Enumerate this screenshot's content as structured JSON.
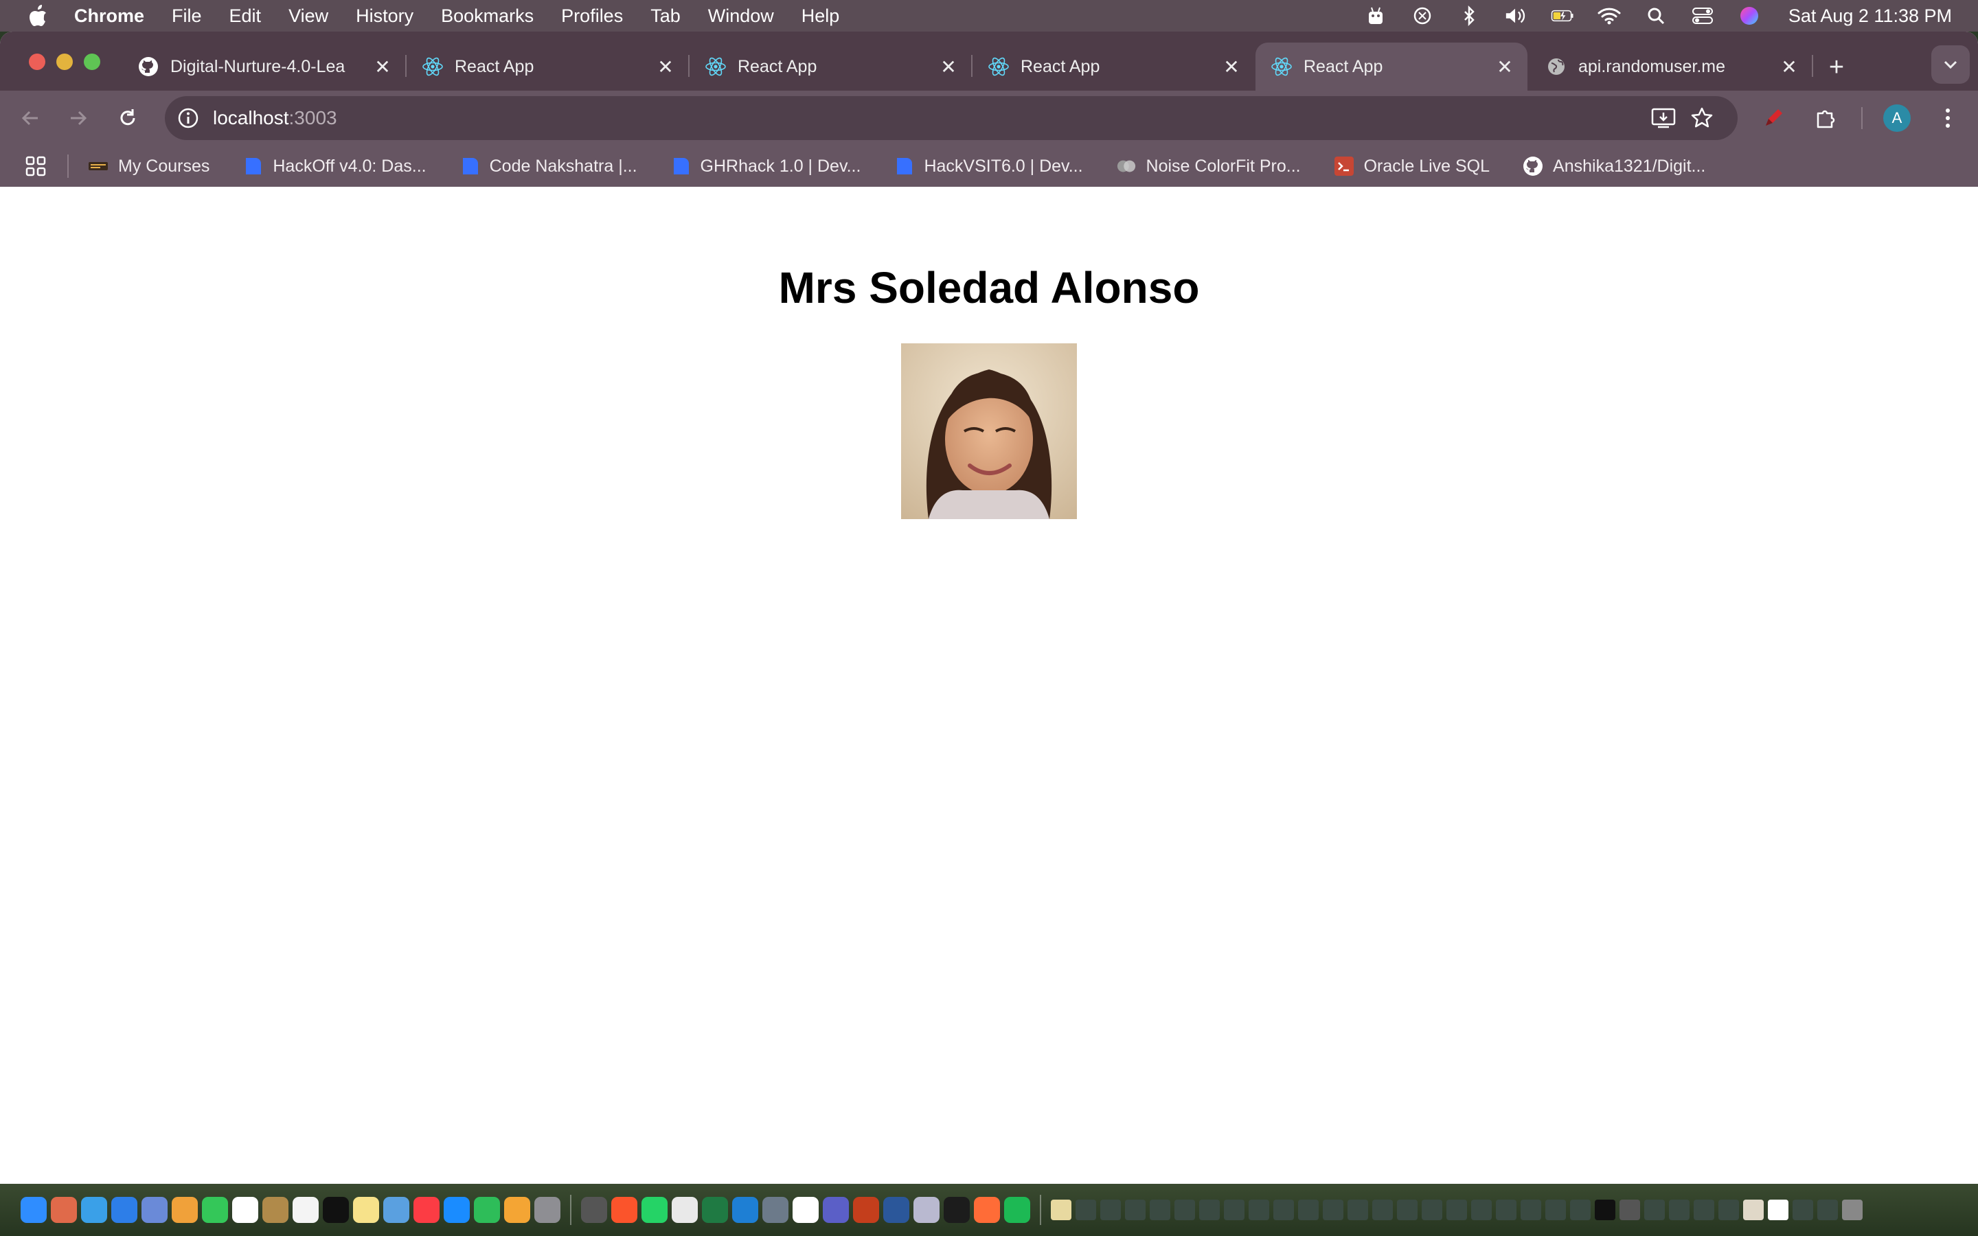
{
  "menubar": {
    "app": "Chrome",
    "items": [
      "File",
      "Edit",
      "View",
      "History",
      "Bookmarks",
      "Profiles",
      "Tab",
      "Window",
      "Help"
    ],
    "clock": "Sat Aug 2  11:38 PM"
  },
  "tabs": [
    {
      "title": "Digital-Nurture-4.0-Lea",
      "icon": "github-icon",
      "active": false
    },
    {
      "title": "React App",
      "icon": "react-icon",
      "active": false
    },
    {
      "title": "React App",
      "icon": "react-icon",
      "active": false
    },
    {
      "title": "React App",
      "icon": "react-icon",
      "active": false
    },
    {
      "title": "React App",
      "icon": "react-icon",
      "active": true
    },
    {
      "title": "api.randomuser.me",
      "icon": "globe-icon",
      "active": false
    }
  ],
  "omnibox": {
    "host": "localhost",
    "port": ":3003"
  },
  "profile": {
    "initial": "A",
    "color": "#2b8ba6"
  },
  "bookmarks": [
    {
      "label": "My Courses",
      "icon": "courses-icon"
    },
    {
      "label": "HackOff v4.0: Das...",
      "icon": "devfolio-icon"
    },
    {
      "label": "Code Nakshatra |...",
      "icon": "devfolio-icon"
    },
    {
      "label": "GHRhack 1.0 | Dev...",
      "icon": "devfolio-icon"
    },
    {
      "label": "HackVSIT6.0 | Dev...",
      "icon": "devfolio-icon"
    },
    {
      "label": "Noise ColorFit Pro...",
      "icon": "noise-icon"
    },
    {
      "label": "Oracle Live SQL",
      "icon": "oracle-icon"
    },
    {
      "label": "Anshika1321/Digit...",
      "icon": "github-icon"
    }
  ],
  "page": {
    "person_name": "Mrs Soledad Alonso"
  },
  "colors": {
    "tabstrip": "#4e3c48",
    "toolbar": "#665562",
    "accent_react": "#61dafb",
    "devfolio_blue": "#3770ff"
  }
}
